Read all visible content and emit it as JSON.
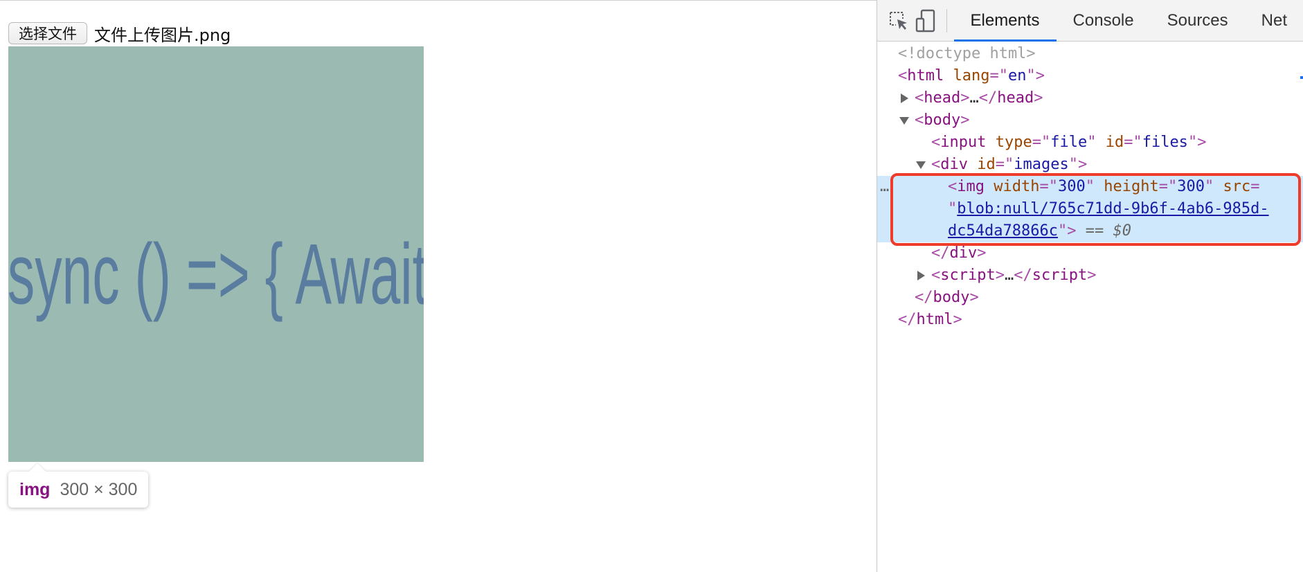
{
  "page": {
    "file_button_label": "选择文件",
    "file_name": "文件上传图片.png",
    "preview_text": "Async () => { Await }",
    "tooltip": {
      "tag": "img",
      "size": "300 × 300"
    }
  },
  "devtools": {
    "tabs": [
      {
        "label": "Elements",
        "active": true
      },
      {
        "label": "Console",
        "active": false
      },
      {
        "label": "Sources",
        "active": false
      },
      {
        "label": "Net",
        "active": false
      }
    ],
    "dom": {
      "doctype": "<!doctype html>",
      "html_open": {
        "tag": "html",
        "attr": "lang",
        "value": "en"
      },
      "head": {
        "tag": "head",
        "ellipsis": "…"
      },
      "body_tag": "body",
      "input": {
        "tag": "input",
        "type_attr": "type",
        "type_value": "file",
        "id_attr": "id",
        "id_value": "files"
      },
      "div": {
        "tag": "div",
        "id_attr": "id",
        "id_value": "images"
      },
      "img": {
        "tag": "img",
        "width_attr": "width",
        "width_value": "300",
        "height_attr": "height",
        "height_value": "300",
        "src_attr": "src",
        "src_part1": "blob:null/765c71dd-9b6f-4ab6-985d-",
        "src_part2": "dc54da78866c",
        "eq": "==",
        "ref": "$0",
        "dots": "…"
      },
      "script": {
        "tag": "script",
        "ellipsis": "…"
      }
    }
  },
  "colors": {
    "preview_bg": "#9dbbb0",
    "preview_text": "#587a9c",
    "selection_bg": "#cfe8fc",
    "highlight_border": "#ef3b2a",
    "active_tab": "#1a73e8"
  },
  "icons": [
    "inspect-element-icon",
    "device-toolbar-icon",
    "collapse-triangle-icon",
    "expand-triangle-icon"
  ]
}
